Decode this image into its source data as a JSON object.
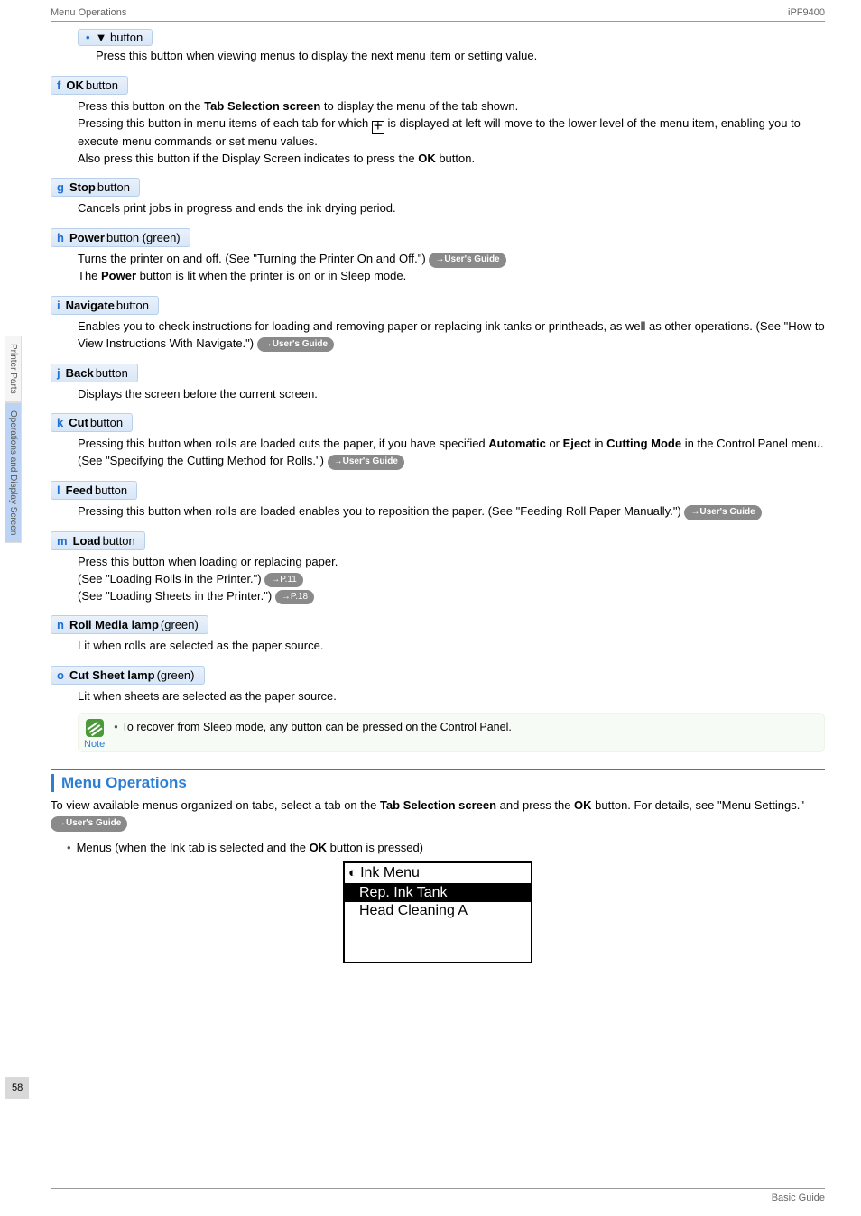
{
  "header": {
    "left": "Menu Operations",
    "right": "iPF9400"
  },
  "sidebar": {
    "tabs": [
      {
        "label": "Printer Parts",
        "active": false
      },
      {
        "label": "Operations and Display Screen",
        "active": true
      }
    ]
  },
  "page_number": "58",
  "sub_bullet": {
    "label": "▼ button",
    "desc": "Press this button when viewing menus to display the next menu item or setting value."
  },
  "items": {
    "f": {
      "letter": "f",
      "name": "OK",
      "suffix": " button",
      "p1_a": "Press this button on the ",
      "p1_b": "Tab Selection screen",
      "p1_c": " to display the menu of the tab shown.",
      "p2_a": "Pressing this button in menu items of each tab for which ",
      "p2_b": " is displayed at left will move to the lower level of the menu item, enabling you to execute menu commands or set menu values.",
      "p3_a": "Also press this button if the Display Screen indicates to press the ",
      "p3_b": "OK",
      "p3_c": " button."
    },
    "g": {
      "letter": "g",
      "name": "Stop",
      "suffix": " button",
      "desc": "Cancels print jobs in progress and ends the ink drying period."
    },
    "h": {
      "letter": "h",
      "name": "Power",
      "suffix": " button (green)",
      "p1": "Turns the printer on and off.  (See \"Turning the Printer On and Off.\") ",
      "p2_a": "The ",
      "p2_b": "Power",
      "p2_c": " button is lit when the printer is on or in Sleep mode."
    },
    "i": {
      "letter": "i",
      "name": "Navigate",
      "suffix": " button",
      "desc": "Enables you to check instructions for loading and removing paper or replacing ink tanks or printheads, as well as other operations.  (See \"How to View Instructions With Navigate.\") "
    },
    "j": {
      "letter": "j",
      "name": "Back",
      "suffix": " button",
      "desc": "Displays the screen before the current screen."
    },
    "k": {
      "letter": "k",
      "name": "Cut",
      "suffix": " button",
      "p_a": "Pressing this button when rolls are loaded cuts the paper, if you have specified ",
      "p_b": "Automatic",
      "p_c": " or ",
      "p_d": "Eject",
      "p_e": " in ",
      "p_f": "Cutting Mode",
      "p_g": " in the Control Panel menu.  (See \"Specifying the Cutting Method for Rolls.\") "
    },
    "l": {
      "letter": "l",
      "name": "Feed",
      "suffix": " button",
      "desc": "Pressing this button when rolls are loaded enables you to reposition the paper.  (See \"Feeding Roll Paper Manually.\") "
    },
    "m": {
      "letter": "m",
      "name": "Load",
      "suffix": " button",
      "p1": "Press this button when loading or replacing paper.",
      "p2": " (See \"Loading Rolls in the Printer.\") ",
      "p3": " (See \"Loading Sheets in the Printer.\") ",
      "pill2": "→P.11",
      "pill3": "→P.18"
    },
    "n": {
      "letter": "n",
      "name": "Roll Media lamp",
      "suffix": " (green)",
      "desc": "Lit when rolls are selected as the paper source."
    },
    "o": {
      "letter": "o",
      "name": "Cut Sheet lamp",
      "suffix": " (green)",
      "desc": "Lit when sheets are selected as the paper source."
    }
  },
  "user_guide_pill": "→User's Guide",
  "note": {
    "label": "Note",
    "text": "To recover from Sleep mode, any button can be pressed on the Control Panel."
  },
  "section": {
    "title": "Menu Operations",
    "p_a": "To view available menus organized on tabs, select a tab on the ",
    "p_b": "Tab Selection screen",
    "p_c": " and press the ",
    "p_d": "OK",
    "p_e": " button. For details, see \"Menu Settings.\" ",
    "bullet_a": "Menus (when the Ink tab is selected and the ",
    "bullet_b": "OK",
    "bullet_c": " button is pressed)"
  },
  "menu_screen": {
    "title": "Ink Menu",
    "row1": "Rep. Ink Tank",
    "row2": "Head Cleaning A"
  },
  "footer": "Basic Guide"
}
